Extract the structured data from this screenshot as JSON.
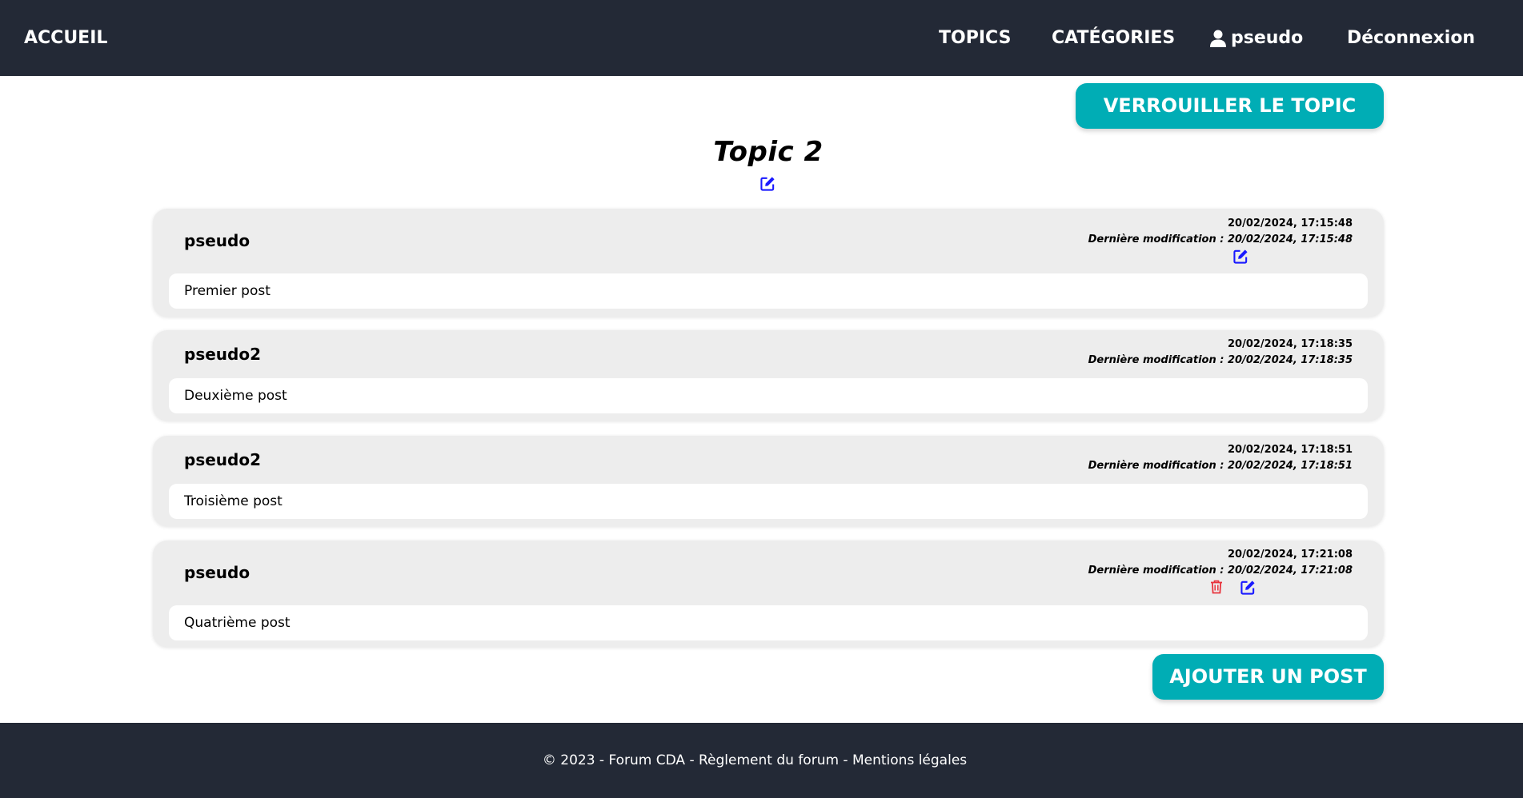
{
  "nav": {
    "home": "ACCUEIL",
    "topics": "TOPICS",
    "categories": "CATÉGORIES",
    "user": "pseudo",
    "logout": "Déconnexion"
  },
  "actions": {
    "lock_topic": "VERROUILLER LE TOPIC",
    "add_post": "AJOUTER UN POST"
  },
  "topic": {
    "title": "Topic 2"
  },
  "posts": [
    {
      "author": "pseudo",
      "date": "20/02/2024, 17:15:48",
      "modified": "Dernière modification : 20/02/2024, 17:15:48",
      "content": "Premier post"
    },
    {
      "author": "pseudo2",
      "date": "20/02/2024, 17:18:35",
      "modified": "Dernière modification : 20/02/2024, 17:18:35",
      "content": "Deuxième post"
    },
    {
      "author": "pseudo2",
      "date": "20/02/2024, 17:18:51",
      "modified": "Dernière modification : 20/02/2024, 17:18:51",
      "content": "Troisième post"
    },
    {
      "author": "pseudo",
      "date": "20/02/2024, 17:21:08",
      "modified": "Dernière modification : 20/02/2024, 17:21:08",
      "content": "Quatrième post"
    }
  ],
  "footer": {
    "copyright": "© 2023 - Forum CDA - ",
    "rules": "Règlement du forum",
    "sep": " - ",
    "legal": "Mentions légales"
  },
  "colors": {
    "navbar": "#232936",
    "accent": "#00adb5",
    "edit_icon": "#1a1aff",
    "delete_icon": "#e8333c"
  }
}
